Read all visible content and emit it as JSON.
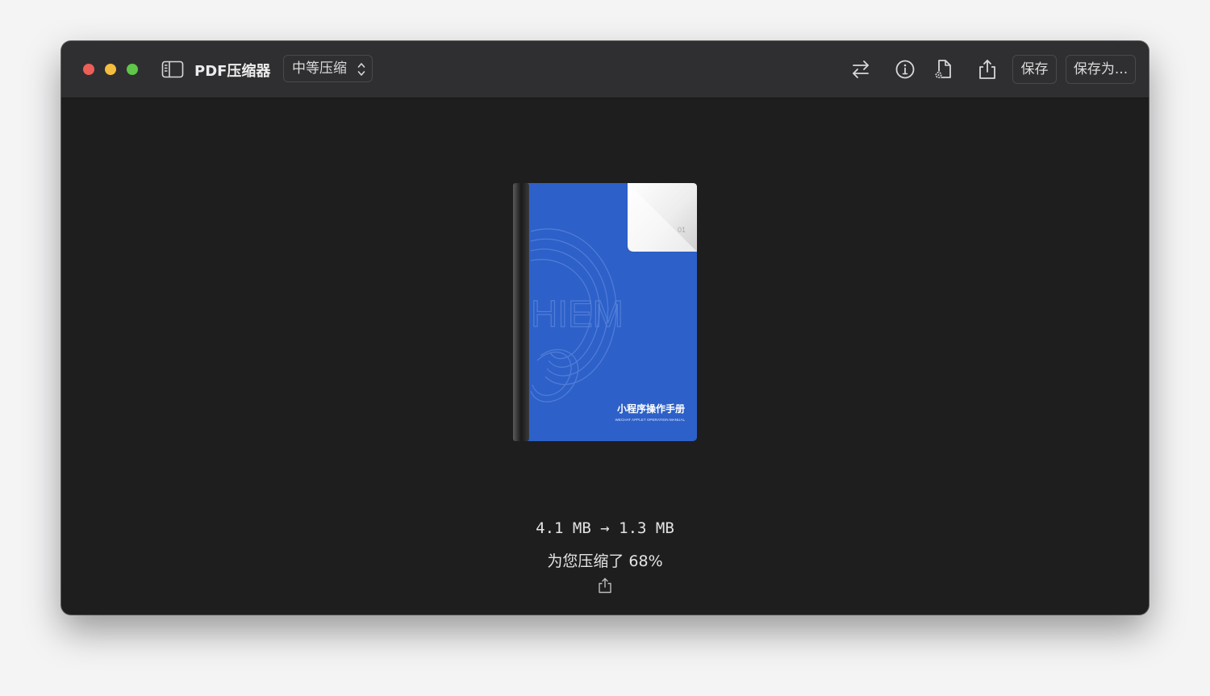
{
  "app": {
    "title": "PDF压缩器"
  },
  "toolbar": {
    "compression_mode": "中等压缩",
    "save_label": "保存",
    "save_as_label": "保存为..."
  },
  "icons": {
    "sidebar": "sidebar-icon",
    "swap": "swap-arrows-icon",
    "info": "info-icon",
    "doc_settings": "document-settings-icon",
    "share": "share-icon"
  },
  "document": {
    "cover_title": "小程序操作手册",
    "cover_subtitle": "WECHAT APPLET OPERATION MANUAL",
    "cover_watermark": "HIEM",
    "page_number": "01"
  },
  "result": {
    "original_size": "4.1 MB",
    "arrow": "→",
    "compressed_size": "1.3 MB",
    "saved_text": "为您压缩了 68%"
  },
  "colors": {
    "titlebar": "#2f2f31",
    "content_bg": "#1e1e1e",
    "cover_blue": "#2d60c8",
    "close": "#ec5f58",
    "minimize": "#f3be3f",
    "zoom": "#5fc64a"
  }
}
